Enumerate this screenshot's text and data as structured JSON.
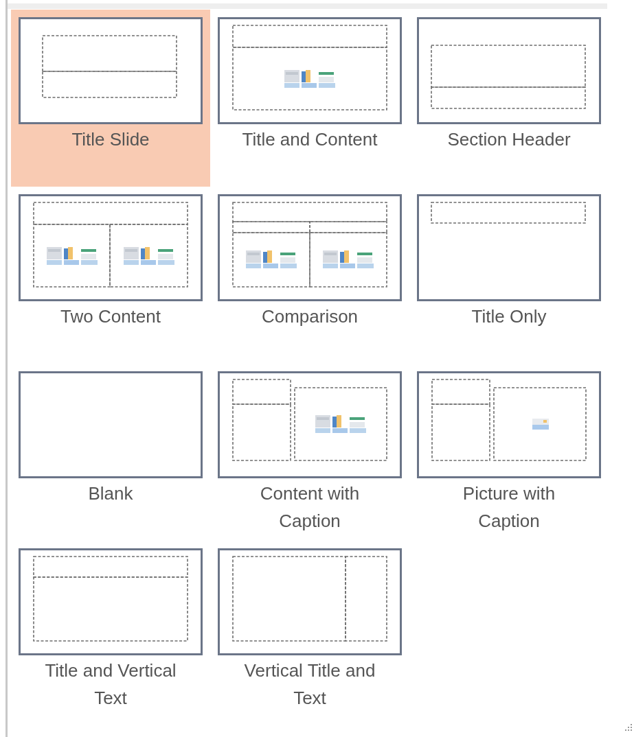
{
  "layouts": [
    {
      "kind": "title_slide",
      "label_lines": [
        "Title Slide"
      ],
      "selected": true
    },
    {
      "kind": "title_content",
      "label_lines": [
        "Title and Content"
      ],
      "selected": false
    },
    {
      "kind": "section_header",
      "label_lines": [
        "Section Header"
      ],
      "selected": false
    },
    {
      "kind": "two_content",
      "label_lines": [
        "Two Content"
      ],
      "selected": false
    },
    {
      "kind": "comparison",
      "label_lines": [
        "Comparison"
      ],
      "selected": false
    },
    {
      "kind": "title_only",
      "label_lines": [
        "Title Only"
      ],
      "selected": false
    },
    {
      "kind": "blank",
      "label_lines": [
        "Blank"
      ],
      "selected": false
    },
    {
      "kind": "content_caption",
      "label_lines": [
        "Content with",
        "Caption"
      ],
      "selected": false
    },
    {
      "kind": "picture_caption",
      "label_lines": [
        "Picture with",
        "Caption"
      ],
      "selected": false
    },
    {
      "kind": "title_vertical_text",
      "label_lines": [
        "Title and Vertical",
        "Text"
      ],
      "selected": false
    },
    {
      "kind": "vertical_title_text",
      "label_lines": [
        "Vertical Title and",
        "Text"
      ],
      "selected": false
    }
  ]
}
